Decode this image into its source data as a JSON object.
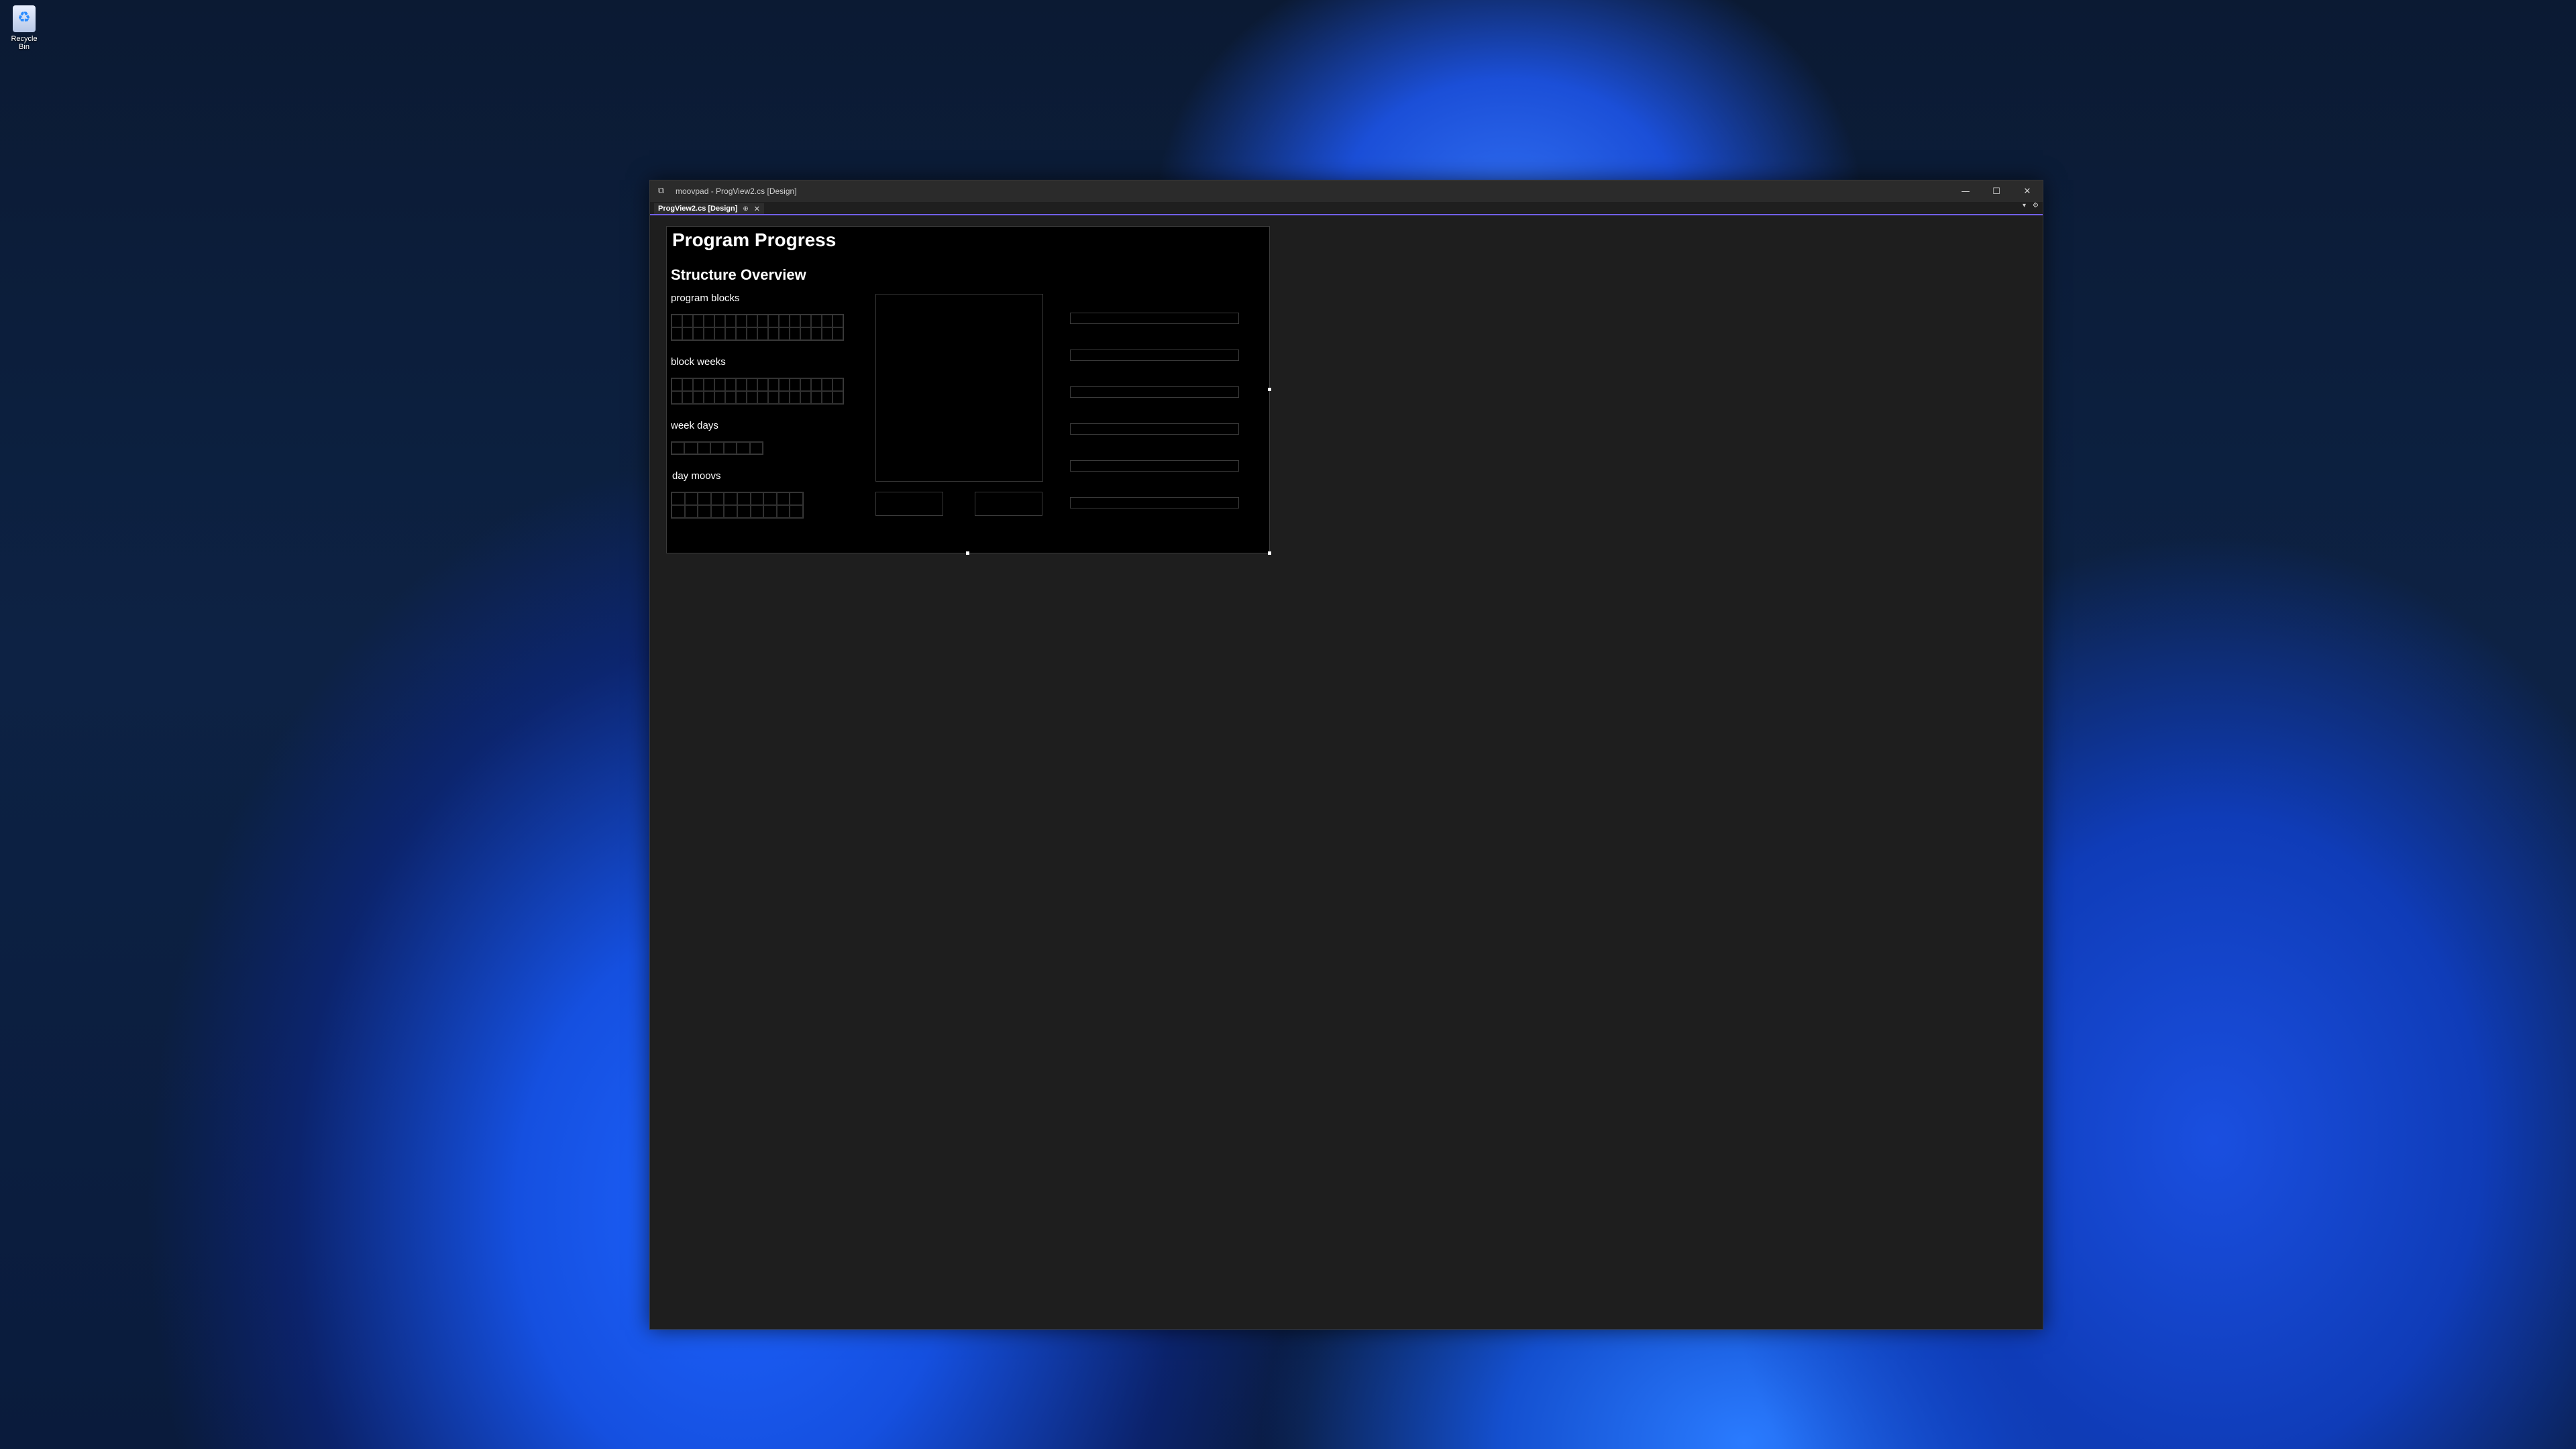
{
  "desktop": {
    "recycle_bin_label": "Recycle Bin"
  },
  "window": {
    "title": "moovpad - ProgView2.cs [Design]",
    "controls": {
      "minimize": "—",
      "maximize": "☐",
      "close": "✕"
    }
  },
  "tabs": [
    {
      "label": "ProgView2.cs [Design]",
      "pin": "⊕",
      "close": "✕"
    }
  ],
  "tabstrip_right": {
    "dropdown": "▾",
    "settings": "⚙"
  },
  "form": {
    "title": "Program Progress",
    "section_title": "Structure Overview",
    "labels": {
      "program_blocks": "program blocks",
      "block_weeks": "block weeks",
      "week_days": "week days",
      "day_moovs": "day moovs"
    }
  },
  "colors": {
    "accent": "#7160e8",
    "form_bg": "#000000",
    "editor_bg": "#1e1e1e"
  }
}
